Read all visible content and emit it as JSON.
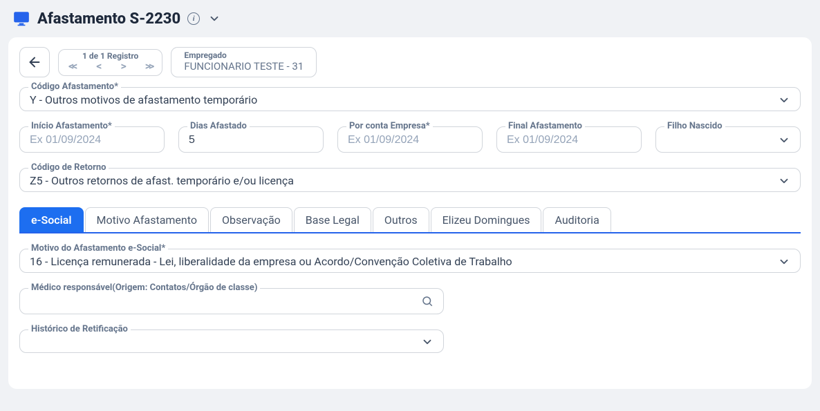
{
  "header": {
    "title": "Afastamento S-2230"
  },
  "toolbar": {
    "pager_label": "1 de 1 Registro",
    "employee_label": "Empregado",
    "employee_value": "FUNCIONARIO TESTE - 31"
  },
  "fields": {
    "codigo_afast": {
      "label": "Código Afastamento*",
      "value": "Y - Outros motivos de afastamento temporário"
    },
    "inicio": {
      "label": "Início Afastamento*",
      "placeholder": "Ex 01/09/2024",
      "value": ""
    },
    "dias": {
      "label": "Dias Afastado",
      "value": "5"
    },
    "por_conta": {
      "label": "Por conta Empresa*",
      "placeholder": "Ex 01/09/2024",
      "value": ""
    },
    "final": {
      "label": "Final Afastamento",
      "placeholder": "Ex 01/09/2024",
      "value": ""
    },
    "filho": {
      "label": "Filho Nascido",
      "value": ""
    },
    "codigo_ret": {
      "label": "Código de Retorno",
      "value": "Z5 - Outros retornos de afast. temporário e/ou licença"
    },
    "motivo_esocial": {
      "label": "Motivo do Afastamento e-Social*",
      "value": "16 - Licença remunerada - Lei, liberalidade da empresa ou Acordo/Convenção Coletiva de Trabalho"
    },
    "medico": {
      "label": "Médico responsável(Origem: Contatos/Órgão de classe)",
      "value": ""
    },
    "historico": {
      "label": "Histórico de Retificação",
      "value": ""
    }
  },
  "tabs": [
    "e-Social",
    "Motivo Afastamento",
    "Observação",
    "Base Legal",
    "Outros",
    "Elizeu Domingues",
    "Auditoria"
  ]
}
